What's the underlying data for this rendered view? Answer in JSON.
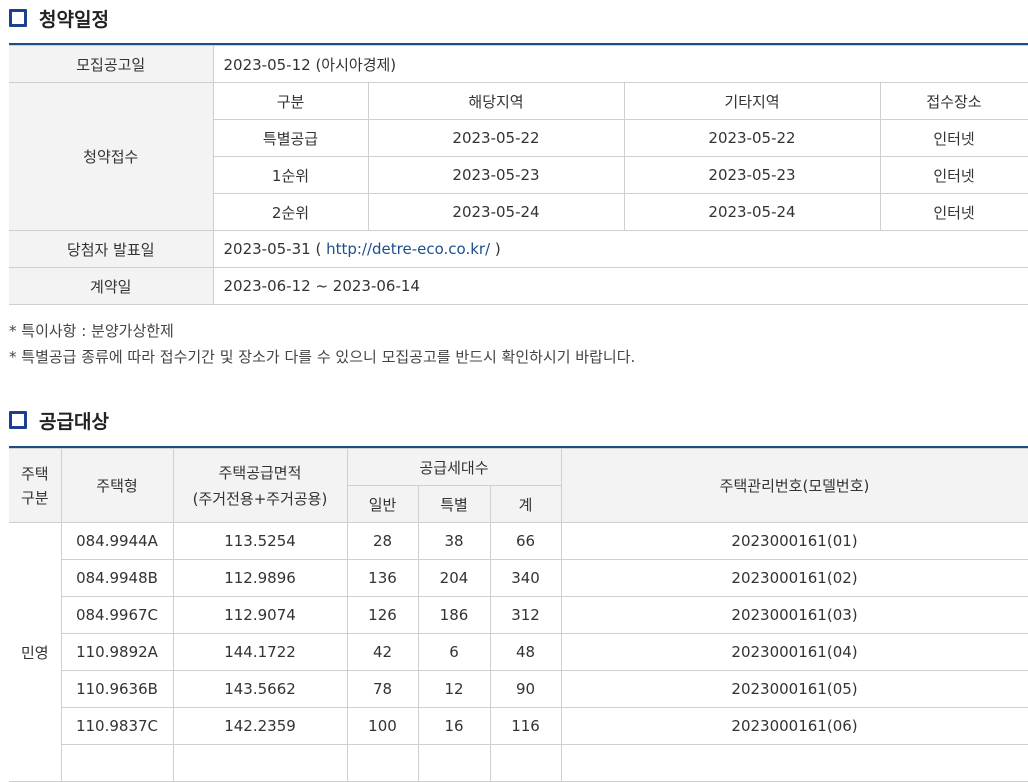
{
  "schedule": {
    "title": "청약일정",
    "announce_label": "모집공고일",
    "announce_value": "2023-05-12 (아시아경제)",
    "apply_label": "청약접수",
    "apply_headers": [
      "구분",
      "해당지역",
      "기타지역",
      "접수장소"
    ],
    "apply_rows": [
      [
        "특별공급",
        "2023-05-22",
        "2023-05-22",
        "인터넷"
      ],
      [
        "1순위",
        "2023-05-23",
        "2023-05-23",
        "인터넷"
      ],
      [
        "2순위",
        "2023-05-24",
        "2023-05-24",
        "인터넷"
      ]
    ],
    "winner_label": "당첨자 발표일",
    "winner_date": "2023-05-31 (",
    "winner_link": "http://detre-eco.co.kr/",
    "winner_close": ")",
    "contract_label": "계약일",
    "contract_value": "2023-06-12 ~ 2023-06-14",
    "note1": "* 특이사항 : 분양가상한제",
    "note2": "* 특별공급 종류에 따라 접수기간 및 장소가 다를 수 있으니 모집공고를 반드시 확인하시기 바랍니다."
  },
  "supply": {
    "title": "공급대상",
    "h_type_group": "주택\n구분",
    "h_type_group_l1": "주택",
    "h_type_group_l2": "구분",
    "h_house_type": "주택형",
    "h_area_l1": "주택공급면적",
    "h_area_l2": "(주거전용+주거공용)",
    "h_units": "공급세대수",
    "h_general": "일반",
    "h_special": "특별",
    "h_total": "계",
    "h_mgmt": "주택관리번호(모델번호)",
    "group_label": "민영",
    "rows": [
      [
        "084.9944A",
        "113.5254",
        "28",
        "38",
        "66",
        "2023000161(01)"
      ],
      [
        "084.9948B",
        "112.9896",
        "136",
        "204",
        "340",
        "2023000161(02)"
      ],
      [
        "084.9967C",
        "112.9074",
        "126",
        "186",
        "312",
        "2023000161(03)"
      ],
      [
        "110.9892A",
        "144.1722",
        "42",
        "6",
        "48",
        "2023000161(04)"
      ],
      [
        "110.9636B",
        "143.5662",
        "78",
        "12",
        "90",
        "2023000161(05)"
      ],
      [
        "110.9837C",
        "142.2359",
        "100",
        "16",
        "116",
        "2023000161(06)"
      ]
    ]
  }
}
